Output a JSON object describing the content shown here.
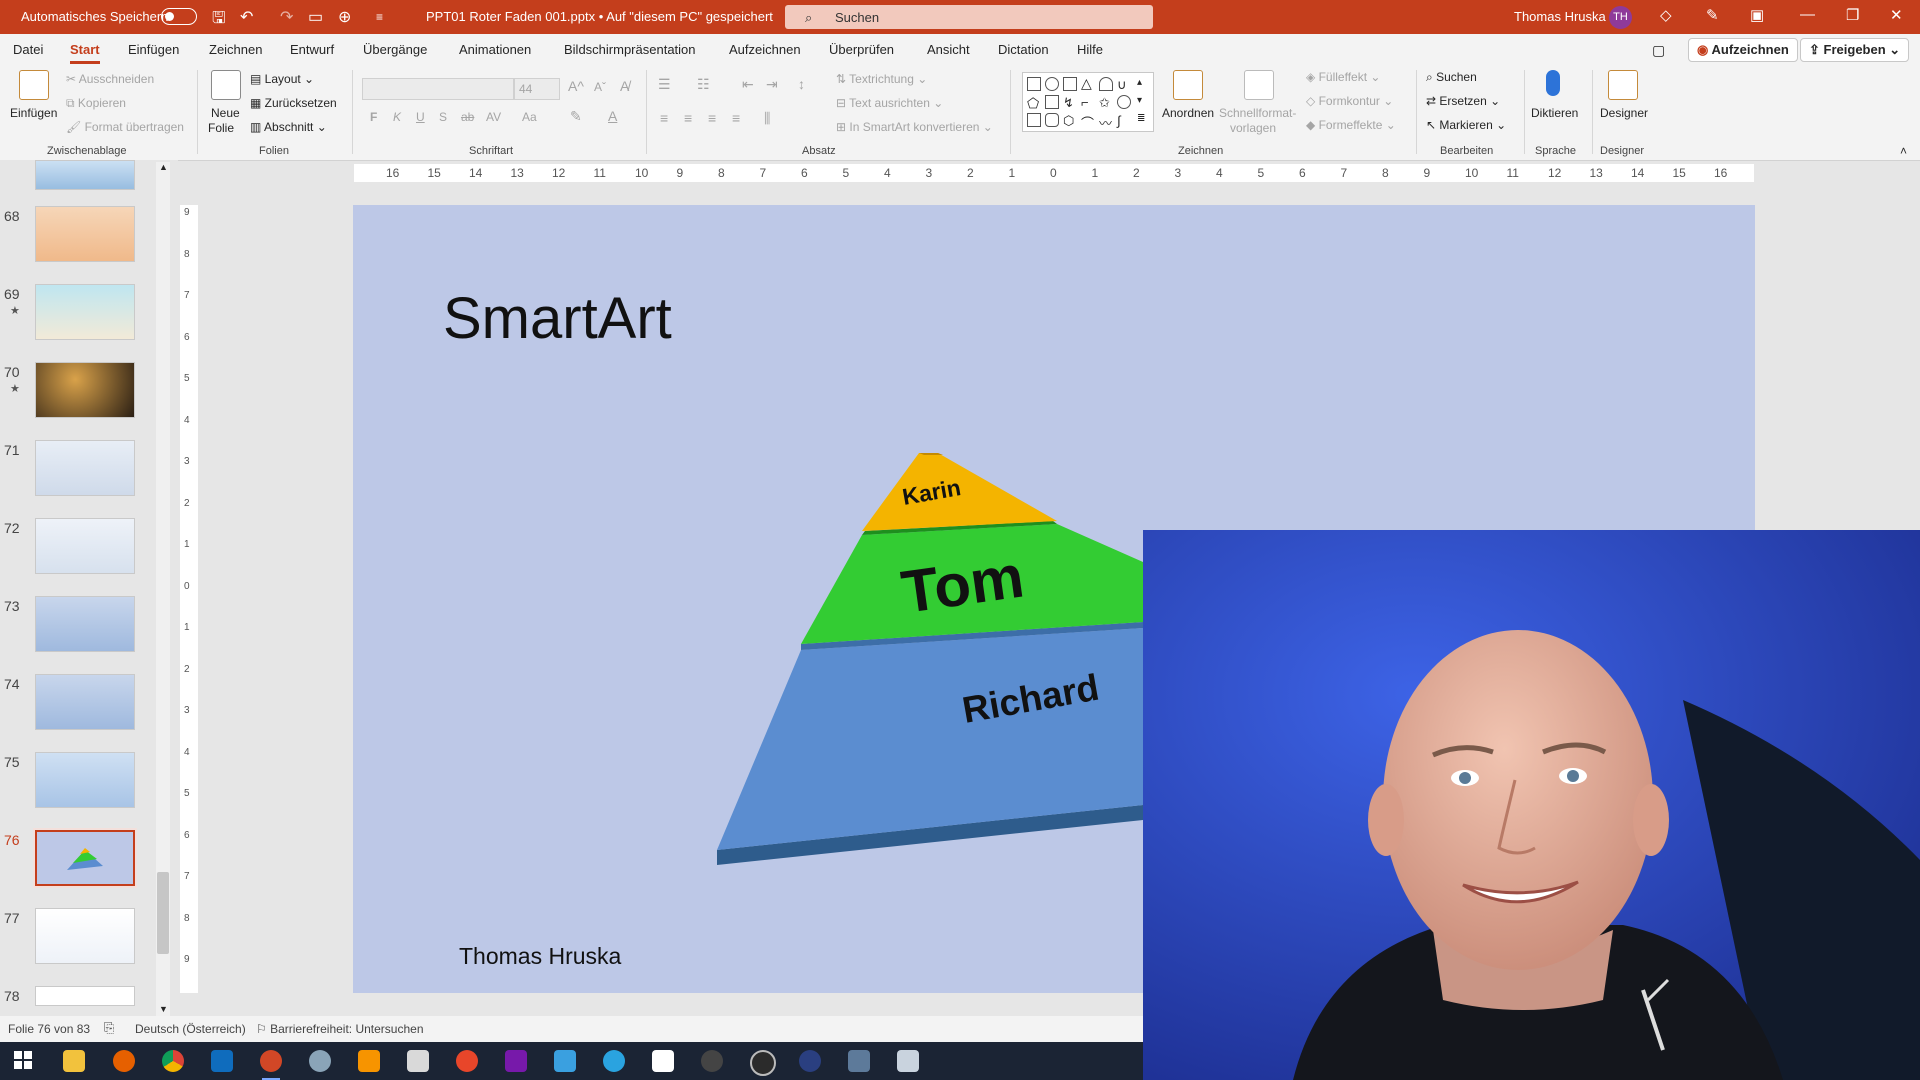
{
  "titlebar": {
    "autosave_label": "Automatisches Speichern",
    "document": "PPT01 Roter Faden 001.pptx • Auf \"diesem PC\" gespeichert",
    "search_placeholder": "Suchen",
    "user_name": "Thomas Hruska",
    "user_initials": "TH",
    "accent_color": "#c43e1c"
  },
  "menu": {
    "tabs": [
      "Datei",
      "Start",
      "Einfügen",
      "Zeichnen",
      "Entwurf",
      "Übergänge",
      "Animationen",
      "Bildschirmpräsentation",
      "Aufzeichnen",
      "Überprüfen",
      "Ansicht",
      "Dictation",
      "Hilfe"
    ],
    "active_tab": "Start",
    "record_button": "Aufzeichnen",
    "share_button": "Freigeben"
  },
  "ribbon": {
    "clipboard": {
      "paste": "Einfügen",
      "cut": "Ausschneiden",
      "copy": "Kopieren",
      "format_painter": "Format übertragen",
      "group": "Zwischenablage"
    },
    "slides": {
      "new_slide_1": "Neue",
      "new_slide_2": "Folie",
      "layout": "Layout",
      "reset": "Zurücksetzen",
      "section": "Abschnitt",
      "group": "Folien"
    },
    "font": {
      "size": "44",
      "bold": "F",
      "italic": "K",
      "underline": "U",
      "shadow": "S",
      "strike": "ab",
      "spacing": "AV",
      "case": "Aa",
      "group": "Schriftart"
    },
    "paragraph": {
      "text_direction": "Textrichtung",
      "align_text": "Text ausrichten",
      "smartart": "In SmartArt konvertieren",
      "group": "Absatz"
    },
    "drawing": {
      "arrange": "Anordnen",
      "quick_styles_1": "Schnellformat-",
      "quick_styles_2": "vorlagen",
      "fill": "Fülleffekt",
      "outline": "Formkontur",
      "effects": "Formeffekte",
      "group": "Zeichnen"
    },
    "editing": {
      "find": "Suchen",
      "replace": "Ersetzen",
      "select": "Markieren",
      "group": "Bearbeiten"
    },
    "voice": {
      "dictate": "Diktieren",
      "group": "Sprache"
    },
    "designer": {
      "designer": "Designer",
      "group": "Designer"
    }
  },
  "thumbnails": [
    {
      "num": "68",
      "star": ""
    },
    {
      "num": "69",
      "star": "★"
    },
    {
      "num": "70",
      "star": "★"
    },
    {
      "num": "71",
      "star": ""
    },
    {
      "num": "72",
      "star": ""
    },
    {
      "num": "73",
      "star": ""
    },
    {
      "num": "74",
      "star": ""
    },
    {
      "num": "75",
      "star": ""
    },
    {
      "num": "76",
      "star": ""
    },
    {
      "num": "77",
      "star": ""
    },
    {
      "num": "78",
      "star": ""
    }
  ],
  "active_slide": "76",
  "ruler_h": [
    "16",
    "15",
    "14",
    "13",
    "12",
    "11",
    "10",
    "9",
    "8",
    "7",
    "6",
    "5",
    "4",
    "3",
    "2",
    "1",
    "0",
    "1",
    "2",
    "3",
    "4",
    "5",
    "6",
    "7",
    "8",
    "9",
    "10",
    "11",
    "12",
    "13",
    "14",
    "15",
    "16"
  ],
  "ruler_v": [
    "9",
    "8",
    "7",
    "6",
    "5",
    "4",
    "3",
    "2",
    "1",
    "0",
    "1",
    "2",
    "3",
    "4",
    "5",
    "6",
    "7",
    "8",
    "9"
  ],
  "slide": {
    "title": "SmartArt",
    "author": "Thomas Hruska",
    "pyramid": {
      "top": "Karin",
      "middle": "Tom",
      "bottom": "Richard"
    },
    "background": "#bdc8e7"
  },
  "status": {
    "slide_info": "Folie 76 von 83",
    "language": "Deutsch (Österreich)",
    "accessibility": "Barrierefreiheit: Untersuchen"
  }
}
